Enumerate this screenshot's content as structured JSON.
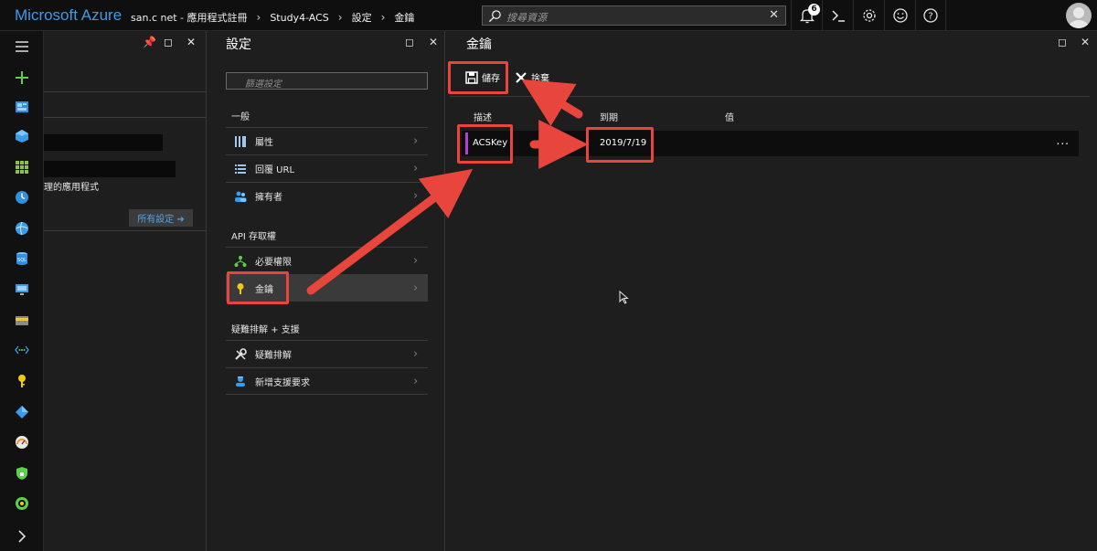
{
  "topbar": {
    "brand": "Microsoft Azure",
    "breadcrumbs": [
      "san.c net - 應用程式註冊",
      "Study4-ACS",
      "設定",
      "金鑰"
    ],
    "search_placeholder": "搜尋資源",
    "notification_count": "6",
    "icons": [
      "bell-icon",
      "cloud-shell-icon",
      "gear-icon",
      "smiley-icon",
      "help-icon",
      "avatar"
    ]
  },
  "rail": {
    "icons": [
      "hamburger-icon",
      "plus-icon",
      "dashboard-icon",
      "cube-icon",
      "grid-icon",
      "clock-icon",
      "globe-icon",
      "sql-icon",
      "monitor-icon",
      "card-icon",
      "network-icon",
      "key-icon",
      "diamond-icon",
      "gauge-icon",
      "shield-icon",
      "circle-icon",
      "chevron-right-icon"
    ]
  },
  "blade1": {
    "text_line": "理的應用程式",
    "all_settings": "所有設定 ➔"
  },
  "settings": {
    "title": "設定",
    "filter_placeholder": "篩選設定",
    "groups": [
      {
        "title": "一般",
        "items": [
          "屬性",
          "回覆 URL",
          "擁有者"
        ]
      },
      {
        "title": "API 存取權",
        "items": [
          "必要權限",
          "金鑰"
        ]
      },
      {
        "title": "疑難排解 + 支援",
        "items": [
          "疑難排解",
          "新增支援要求"
        ]
      }
    ]
  },
  "keys": {
    "title": "金鑰",
    "save": "儲存",
    "discard": "捨棄",
    "columns": [
      "描述",
      "到期",
      "值"
    ],
    "rows": [
      {
        "description": "ACSKey",
        "expires": "2019/7/19",
        "value": "",
        "more": "..."
      }
    ]
  },
  "colors": {
    "accent": "#3c9bea",
    "annotation": "#e8453c",
    "key_indicator": "#b040d8",
    "background": "#1e1e1e"
  }
}
